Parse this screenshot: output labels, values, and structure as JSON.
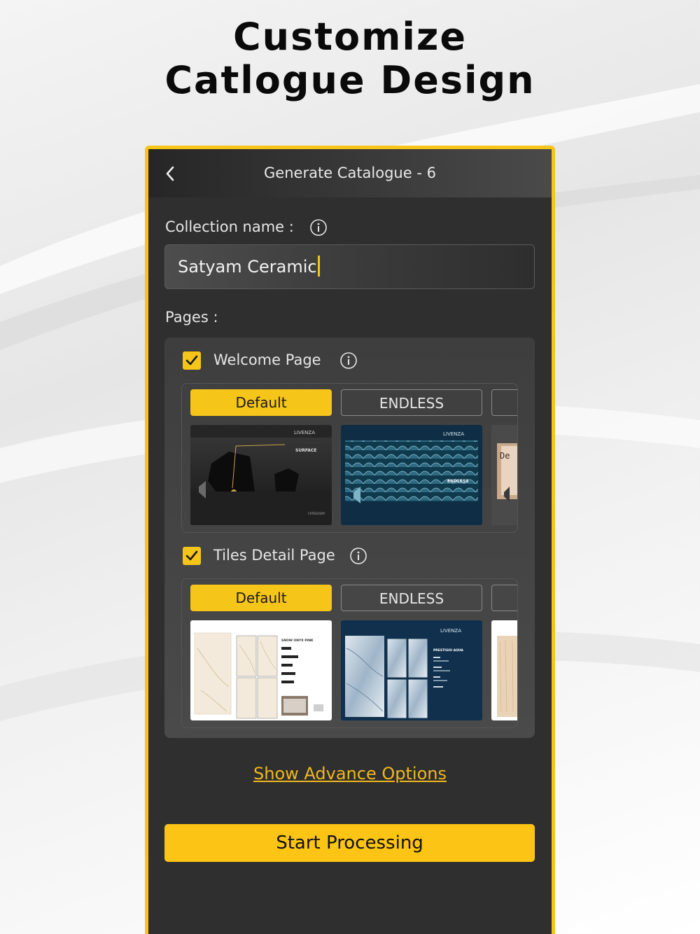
{
  "headline": {
    "line1": "Customize",
    "line2": "Catlogue Design"
  },
  "screen": {
    "title": "Generate Catalogue - 6",
    "collection_label": "Collection name :",
    "collection_value": "Satyam Ceramic",
    "pages_label": "Pages :",
    "sections": [
      {
        "label": "Welcome Page",
        "checked": true,
        "tabs": [
          "Default",
          "ENDLESS"
        ],
        "active_tab": "Default"
      },
      {
        "label": "Tiles Detail Page",
        "checked": true,
        "tabs": [
          "Default",
          "ENDLESS"
        ],
        "active_tab": "Default"
      }
    ],
    "thumbs": {
      "brand": "LIVENZA",
      "surface": "SURFACE",
      "category": "CATEGOURY",
      "endless": "ENDLESS",
      "snow": "SNOW ONYX PINK",
      "prestigio": "PRESTIGIO AQUA",
      "partial": "De"
    },
    "advance_link": "Show Advance Options",
    "start_button": "Start Processing"
  },
  "colors": {
    "accent": "#f6c519",
    "panel": "#2f2f2f",
    "link": "#f0b81c"
  }
}
